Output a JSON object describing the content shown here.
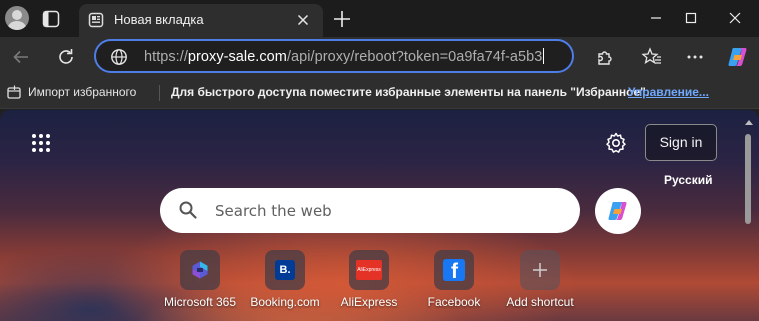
{
  "colors": {
    "accent": "#4f7de8",
    "link": "#6fa8ff",
    "tab_bg": "#2e2e2e",
    "titlebar_bg": "#1c1c1c"
  },
  "tab": {
    "title": "Новая вкладка",
    "favicon": "new-tab-page-icon"
  },
  "address": {
    "scheme": "https://",
    "host": "proxy-sale.com",
    "path": "/api/proxy/reboot?token=0a9fa74f-a5b3"
  },
  "favorites_bar": {
    "import_label": "Импорт избранного",
    "hint": "Для быстрого доступа поместите избранные элементы на панель \"Избранное\".",
    "manage_link": "Управление..."
  },
  "ntp": {
    "sign_in": "Sign in",
    "language": "Русский",
    "search_placeholder": "Search the web",
    "shortcuts": [
      {
        "label": "Microsoft 365",
        "icon": "microsoft-365-icon"
      },
      {
        "label": "Booking.com",
        "icon": "booking-icon",
        "glyph": "B."
      },
      {
        "label": "AliExpress",
        "icon": "aliexpress-icon",
        "glyph": "AliExpress"
      },
      {
        "label": "Facebook",
        "icon": "facebook-icon",
        "glyph": "f"
      },
      {
        "label": "Add shortcut",
        "icon": "plus-icon"
      }
    ]
  }
}
